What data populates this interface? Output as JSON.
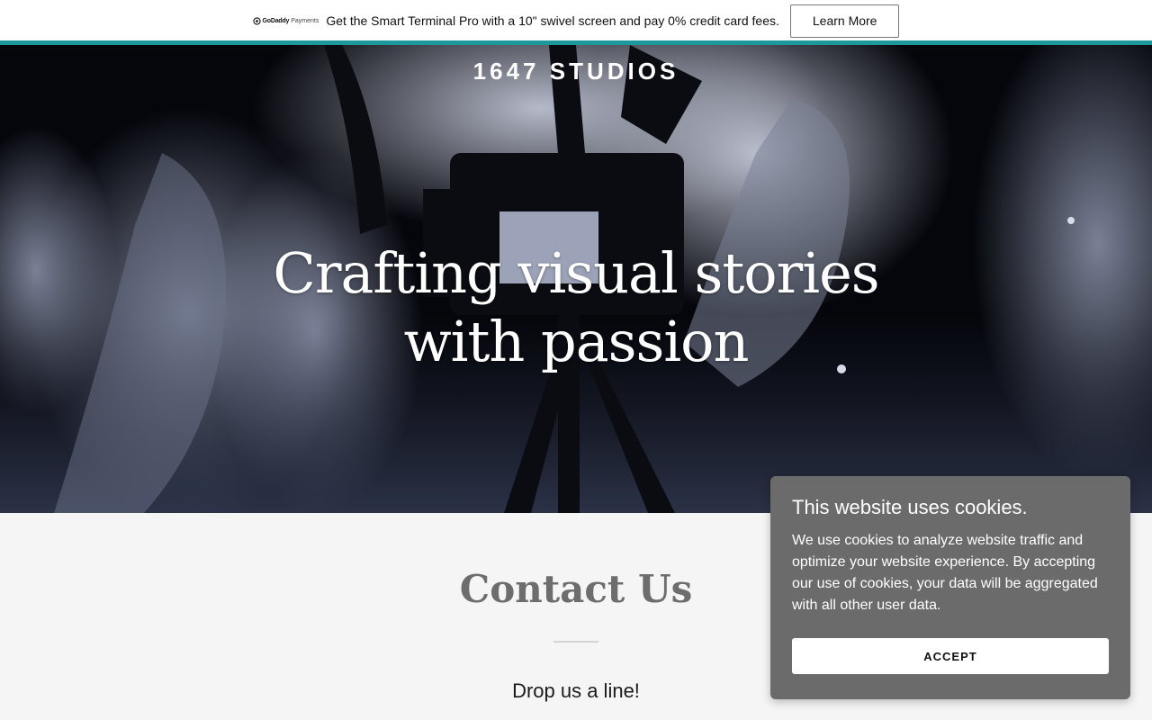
{
  "promo": {
    "logo_brand": "GoDaddy",
    "logo_sub": "Payments",
    "text": "Get the Smart Terminal Pro with a 10\" swivel screen and pay 0% credit card fees.",
    "button_label": "Learn More"
  },
  "hero": {
    "site_title": "1647 STUDIOS",
    "headline": "Crafting visual stories with passion"
  },
  "contact": {
    "heading": "Contact Us",
    "subheading": "Drop us a line!"
  },
  "cookie": {
    "title": "This website uses cookies.",
    "body": "We use cookies to analyze website traffic and optimize your website experience. By accepting our use of cookies, your data will be aggregated with all other user data.",
    "accept_label": "ACCEPT"
  },
  "colors": {
    "accent": "#1c9a9b",
    "cookie_panel": "#6b6b6b",
    "heading_gray": "#6d6d6d"
  }
}
